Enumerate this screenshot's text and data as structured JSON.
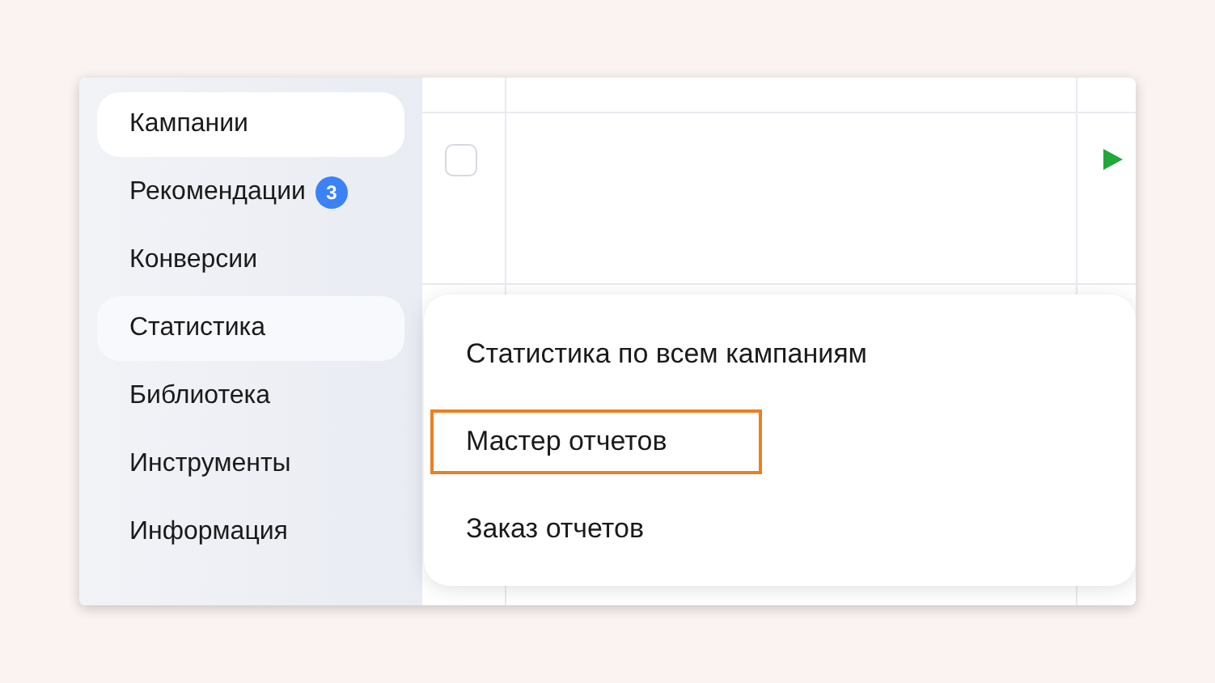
{
  "sidebar": {
    "items": [
      {
        "label": "Кампании",
        "selected": true,
        "open": false
      },
      {
        "label": "Рекомендации",
        "badge": "3",
        "selected": false,
        "open": false
      },
      {
        "label": "Конверсии",
        "selected": false,
        "open": false
      },
      {
        "label": "Статистика",
        "selected": false,
        "open": true
      },
      {
        "label": "Библиотека",
        "selected": false,
        "open": false
      },
      {
        "label": "Инструменты",
        "selected": false,
        "open": false
      },
      {
        "label": "Информация",
        "selected": false,
        "open": false
      }
    ]
  },
  "table": {
    "row": {
      "checked": false,
      "running": true
    }
  },
  "menu": {
    "items": [
      {
        "label": "Статистика по всем кампаниям",
        "highlighted": false
      },
      {
        "label": "Мастер отчетов",
        "highlighted": true
      },
      {
        "label": "Заказ отчетов",
        "highlighted": false
      }
    ]
  }
}
